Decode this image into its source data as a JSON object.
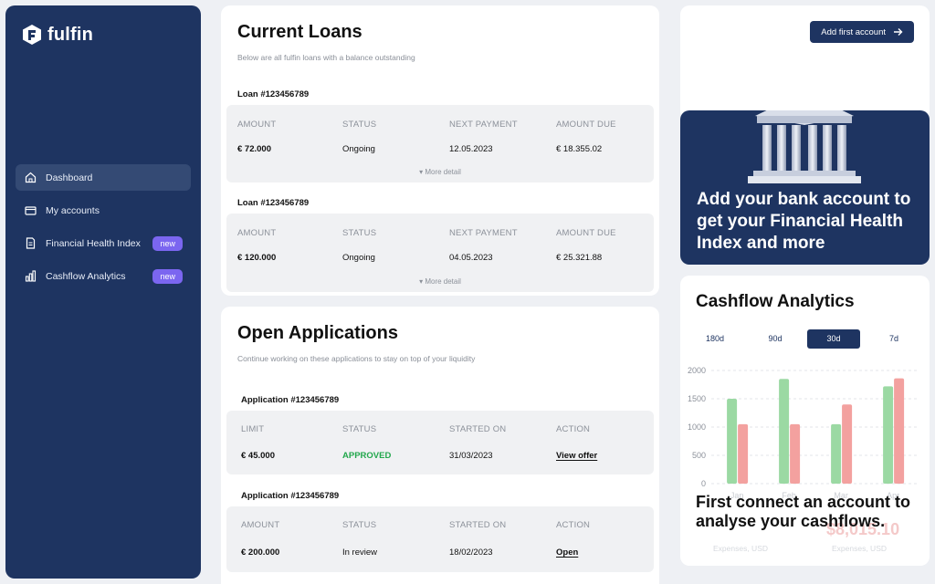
{
  "brand": {
    "name": "fulfin"
  },
  "sidebar": {
    "items": [
      {
        "label": "Dashboard",
        "icon": "home-icon",
        "badge": ""
      },
      {
        "label": "My accounts",
        "icon": "card-icon",
        "badge": ""
      },
      {
        "label": "Financial Health Index",
        "icon": "document-icon",
        "badge": "new"
      },
      {
        "label": "Cashflow Analytics",
        "icon": "bar-chart-icon",
        "badge": "new"
      }
    ]
  },
  "loans": {
    "title": "Current Loans",
    "subtitle": "Below are all fulfin loans with a balance outstanding",
    "headers": [
      "AMOUNT",
      "STATUS",
      "NEXT PAYMENT",
      "AMOUNT DUE"
    ],
    "more_label": "More detail",
    "items": [
      {
        "label": "Loan #123456789",
        "amount": "€ 72.000",
        "status": "Ongoing",
        "next_payment": "12.05.2023",
        "amount_due": "€ 18.355.02"
      },
      {
        "label": "Loan #123456789",
        "amount": "€ 120.000",
        "status": "Ongoing",
        "next_payment": "04.05.2023",
        "amount_due": "€ 25.321.88"
      }
    ]
  },
  "applications": {
    "title": "Open Applications",
    "subtitle": "Continue working on these applications to stay on top of your liquidity",
    "items": [
      {
        "label": "Application #123456789",
        "headers": [
          "LIMIT",
          "STATUS",
          "STARTED ON",
          "ACTION"
        ],
        "value": "€ 45.000",
        "status": "APPROVED",
        "started": "31/03/2023",
        "action": "View offer"
      },
      {
        "label": "Application #123456789",
        "headers": [
          "AMOUNT",
          "STATUS",
          "STARTED ON",
          "ACTION"
        ],
        "value": "€ 200.000",
        "status": "In review",
        "started": "18/02/2023",
        "action": "Open"
      }
    ]
  },
  "account": {
    "add_button": "Add first account",
    "promo_text": "Add your bank account to get your Financial Health Index and more"
  },
  "cashflow": {
    "title": "Cashflow Analytics",
    "periods": [
      "180d",
      "90d",
      "30d",
      "7d"
    ],
    "active_period": "30d",
    "overlay_text": "First connect an account to analyse your cashflows.",
    "ghost_value": "$8,015.10",
    "ghost_label_left": "Expenses, USD",
    "ghost_label_right": "Expenses, USD",
    "colors": {
      "income": "#9bd9a3",
      "expenses": "#f3a19f"
    }
  },
  "chart_data": {
    "type": "bar",
    "categories": [
      "Jan",
      "Feb",
      "Mar",
      "Apr"
    ],
    "series": [
      {
        "values": [
          1500,
          1850,
          1050,
          1720
        ]
      },
      {
        "values": [
          1050,
          1050,
          1400,
          1860
        ]
      }
    ],
    "yticks": [
      0,
      500,
      1000,
      1500,
      2000
    ],
    "ylim": [
      0,
      2000
    ],
    "grid": true
  }
}
